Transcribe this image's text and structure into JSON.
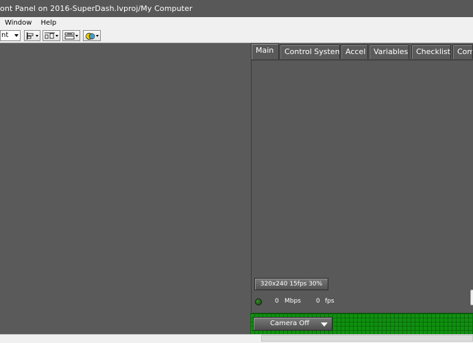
{
  "window": {
    "title": "ont Panel on 2016-SuperDash.lvproj/My Computer"
  },
  "menubar": {
    "items": [
      "Window",
      "Help"
    ]
  },
  "toolbar": {
    "font_combo": "nt",
    "buttons": [
      "align-objects-icon",
      "distribute-objects-icon",
      "resize-objects-icon",
      "reorder-icon"
    ]
  },
  "tabs": {
    "items": [
      "Main",
      "Control System",
      "Accel",
      "Variables",
      "Checklist",
      "Com"
    ],
    "active": "Main"
  },
  "camera": {
    "resolution_button": "320x240   15fps   30%",
    "mbps_value": "0",
    "mbps_unit": "Mbps",
    "fps_value": "0",
    "fps_unit": "fps",
    "mode_select": "Camera Off"
  },
  "colors": {
    "panel_background": "#5a5a5a",
    "status_bar_green": "#109010",
    "indicator_led": "#2e6b24"
  }
}
